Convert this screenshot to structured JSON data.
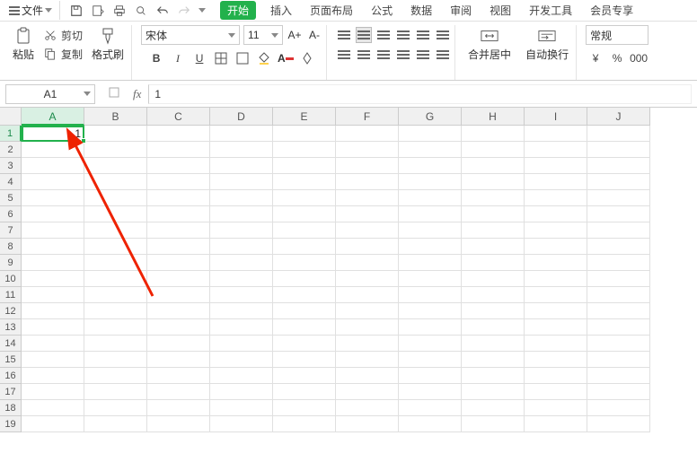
{
  "menubar": {
    "file_label": "文件",
    "tabs": [
      "开始",
      "插入",
      "页面布局",
      "公式",
      "数据",
      "审阅",
      "视图",
      "开发工具",
      "会员专享"
    ],
    "active_tab": "开始"
  },
  "ribbon": {
    "paste_label": "粘贴",
    "cut_label": "剪切",
    "copy_label": "复制",
    "format_painter_label": "格式刷",
    "font_name": "宋体",
    "font_size": "11",
    "bold": "B",
    "italic": "I",
    "underline": "U",
    "increase_font": "A",
    "decrease_font": "A",
    "merge_label": "合并居中",
    "wrap_label": "自动换行",
    "number_format": "常规",
    "currency": "¥",
    "percent": "%",
    "thousands_icon": "000"
  },
  "formula_bar": {
    "name_box": "A1",
    "fx_label": "fx",
    "formula_value": "1"
  },
  "grid": {
    "columns": [
      "A",
      "B",
      "C",
      "D",
      "E",
      "F",
      "G",
      "H",
      "I",
      "J"
    ],
    "rows": [
      1,
      2,
      3,
      4,
      5,
      6,
      7,
      8,
      9,
      10,
      11,
      12,
      13,
      14,
      15,
      16,
      17,
      18,
      19
    ],
    "selected_cell": "A1",
    "selected_column": "A",
    "selected_row": 1,
    "cell_values": {
      "A1": "1"
    }
  }
}
